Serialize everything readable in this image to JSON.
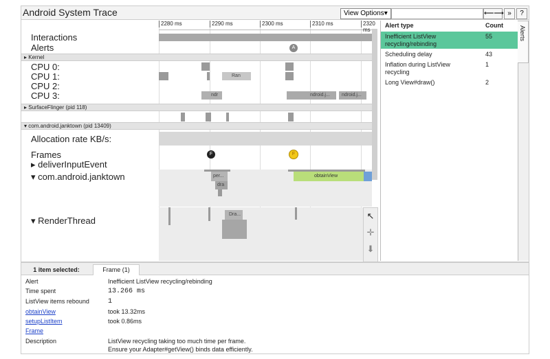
{
  "titlebar": {
    "title": "Android System Trace",
    "view_options": "View Options▾",
    "search_placeholder": "",
    "zoom_btn": "⟵⟶",
    "more_btn": "»",
    "help_btn": "?"
  },
  "ruler": {
    "ticks": [
      "2280 ms",
      "2290 ms",
      "2300 ms",
      "2310 ms",
      "2320 ms"
    ]
  },
  "tracks": {
    "interactions": "Interactions",
    "alerts": "Alerts",
    "kernel": "▸ Kernel",
    "cpu0": "CPU 0:",
    "cpu1": "CPU 1:",
    "cpu2": "CPU 2:",
    "cpu3": "CPU 3:",
    "surfaceflinger": "▸ SurfaceFlinger (pid 118)",
    "janktown": "▾ com.android.janktown (pid 13409)",
    "allocation": "Allocation rate KB/s:",
    "frames": "Frames",
    "deliver": "▸ deliverInputEvent",
    "janktown_thread": "▾ com.android.janktown",
    "renderthread": "▾ RenderThread"
  },
  "slices": {
    "ran": "Ran",
    "ndr": "ndr",
    "ndroid1": "ndroid.j...",
    "ndroid2": "ndroid.j...",
    "per": "per...",
    "dra_small": "dra",
    "obtain": "obtainView",
    "dra_render": "Dra..."
  },
  "markers": {
    "alert": "A",
    "frame_f": "F",
    "frame_yellow": "F"
  },
  "colors": {
    "alert_selected": "#5bc79b",
    "obtainview": "#b9de7a",
    "frame_yellow": "#f2c81a"
  },
  "alerts_panel": {
    "tab": "Alerts",
    "header_type": "Alert type",
    "header_count": "Count",
    "rows": [
      {
        "type": "Inefficient ListView recycling/rebinding",
        "count": "55"
      },
      {
        "type": "Scheduling delay",
        "count": "43"
      },
      {
        "type": "Inflation during ListView recycling",
        "count": "1"
      },
      {
        "type": "Long View#draw()",
        "count": "2"
      }
    ]
  },
  "bottom": {
    "tab_selected": "1 item selected:",
    "tab_frame": "Frame (1)",
    "rows": [
      {
        "key": "Alert",
        "value": "Inefficient ListView recycling/rebinding"
      },
      {
        "key": "Time spent",
        "value": "13.266 ms"
      },
      {
        "key": "ListView items rebound",
        "value": "1"
      },
      {
        "key": "obtainView",
        "value": "took 13.32ms"
      },
      {
        "key": "setupListItem",
        "value": "took 0.86ms"
      },
      {
        "key": "Frame",
        "value": ""
      },
      {
        "key": "Description",
        "value": "ListView recycling taking too much time per frame."
      },
      {
        "key": "",
        "value": "Ensure your Adapter#getView() binds data efficiently."
      }
    ]
  }
}
